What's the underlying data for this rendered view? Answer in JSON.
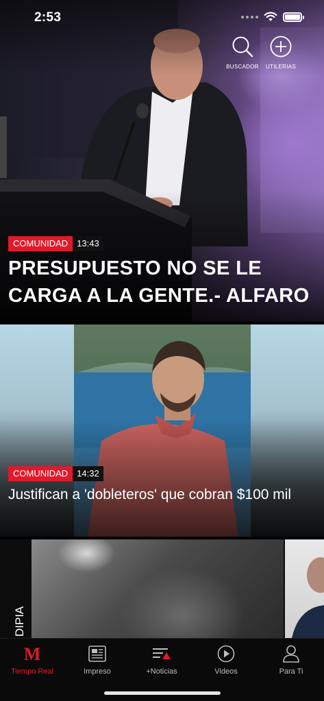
{
  "status_bar": {
    "time": "2:53"
  },
  "toolbar": {
    "search_label": "BUSCADOR",
    "tools_label": "UTILERIAS"
  },
  "feed": [
    {
      "section": "COMUNIDAD",
      "time": "13:43",
      "headline": "PRESUPUESTO NO SE LE CARGA A LA GENTE.- ALFARO"
    },
    {
      "section": "COMUNIDAD",
      "time": "14:32",
      "headline": "Justifican a 'dobleteros' que cobran $100 mil"
    },
    {
      "side_text": "DIPIA"
    }
  ],
  "tab_bar": {
    "items": [
      {
        "label": "Tiempo Real",
        "icon": "m-logo-icon",
        "active": true
      },
      {
        "label": "Impreso",
        "icon": "newspaper-icon",
        "active": false
      },
      {
        "label": "+Noticias",
        "icon": "more-news-icon",
        "active": false
      },
      {
        "label": "Videos",
        "icon": "play-circle-icon",
        "active": false
      },
      {
        "label": "Para Ti",
        "icon": "user-icon",
        "active": false
      }
    ]
  },
  "colors": {
    "accent": "#e01a2b",
    "time_badge": "#111111",
    "tab_inactive": "#bdbdbd"
  }
}
